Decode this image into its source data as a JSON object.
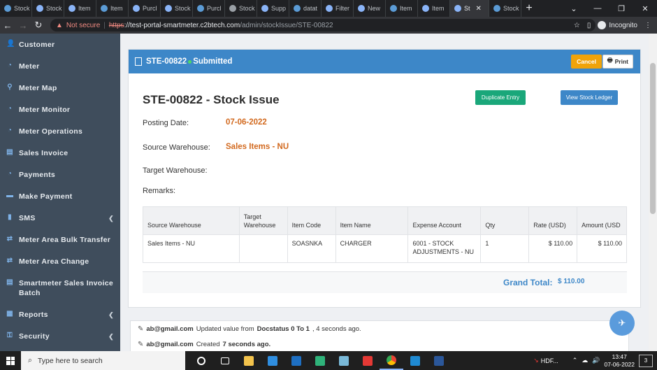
{
  "browser": {
    "tabs": [
      {
        "label": "Stock",
        "active": false
      },
      {
        "label": "Stock",
        "active": false
      },
      {
        "label": "Item",
        "active": false
      },
      {
        "label": "Item",
        "active": false
      },
      {
        "label": "Purcl",
        "active": false
      },
      {
        "label": "Stock",
        "active": false
      },
      {
        "label": "Purcl",
        "active": false
      },
      {
        "label": "Stock",
        "active": false
      },
      {
        "label": "Supp",
        "active": false
      },
      {
        "label": "datat",
        "active": false
      },
      {
        "label": "Filter",
        "active": false
      },
      {
        "label": "New",
        "active": false
      },
      {
        "label": "Item",
        "active": false
      },
      {
        "label": "Item",
        "active": false
      },
      {
        "label": "St",
        "active": true
      },
      {
        "label": "Stock",
        "active": false
      }
    ],
    "new_tab": "+",
    "security_label": "Not secure",
    "url_scheme": "https",
    "url_host": "://test-portal-smartmeter.c2btech.com",
    "url_path": "/admin/stockIssue/STE-00822",
    "profile_label": "Incognito"
  },
  "sidebar": {
    "items": [
      {
        "label": "Customer",
        "icon": "user-icon",
        "submenu": false
      },
      {
        "label": "Meter",
        "icon": "meter-icon",
        "submenu": false
      },
      {
        "label": "Meter Map",
        "icon": "map-pin-icon",
        "submenu": false
      },
      {
        "label": "Meter Monitor",
        "icon": "meter-icon",
        "submenu": false
      },
      {
        "label": "Meter Operations",
        "icon": "meter-icon",
        "submenu": false
      },
      {
        "label": "Sales Invoice",
        "icon": "file-icon",
        "submenu": false
      },
      {
        "label": "Payments",
        "icon": "meter-icon",
        "submenu": false
      },
      {
        "label": "Make Payment",
        "icon": "money-icon",
        "submenu": false
      },
      {
        "label": "SMS",
        "icon": "mobile-icon",
        "submenu": true
      },
      {
        "label": "Meter Area Bulk Transfer",
        "icon": "transfer-icon",
        "submenu": false
      },
      {
        "label": "Meter Area Change",
        "icon": "transfer-icon",
        "submenu": false
      },
      {
        "label": "Smartmeter Sales Invoice Batch",
        "icon": "file-icon",
        "submenu": false
      },
      {
        "label": "Reports",
        "icon": "report-icon",
        "submenu": true
      },
      {
        "label": "Security",
        "icon": "lock-icon",
        "submenu": true
      }
    ]
  },
  "doc": {
    "header_id": "STE-00822",
    "status": "Submitted",
    "cancel_label": "Cancel",
    "print_label": "Print",
    "title": "STE-00822 - Stock Issue",
    "duplicate_label": "Duplicate Entry",
    "ledger_label": "View Stock Ledger",
    "posting_date_label": "Posting Date:",
    "posting_date": "07-06-2022",
    "source_wh_label": "Source Warehouse:",
    "source_wh": "Sales Items - NU",
    "target_wh_label": "Target Warehouse:",
    "remarks_label": "Remarks:",
    "columns": [
      "Source Warehouse",
      "Target Warehouse",
      "Item Code",
      "Item Name",
      "Expense Account",
      "Qty",
      "Rate (USD)",
      "Amount (USD"
    ],
    "rows": [
      {
        "source_wh": "Sales Items - NU",
        "target_wh": "",
        "item_code": "SOASNKA",
        "item_name": "CHARGER",
        "expense_account": "6001 - STOCK ADJUSTMENTS - NU",
        "qty": "1",
        "rate": "$ 110.00",
        "amount": "$ 110.00"
      }
    ],
    "grand_total_label": "Grand Total:",
    "grand_total": "$ 110.00"
  },
  "activity": [
    {
      "user": "ab@gmail.com",
      "text_a": "Updated value from",
      "field": "Docstatus 0 To 1",
      "text_b": ", 4 seconds ago."
    },
    {
      "user": "ab@gmail.com",
      "text_a": "Created",
      "field": "7 seconds ago.",
      "text_b": ""
    }
  ],
  "taskbar": {
    "search_placeholder": "Type here to search",
    "tray_label": "HDF...",
    "time": "13:47",
    "date": "07-06-2022",
    "notifications": "3"
  },
  "colors": {
    "sidebar_bg": "#3f4d5c",
    "header_blue": "#3d87c8",
    "cancel_orange": "#f0a30a",
    "duplicate_green": "#1aa77a",
    "value_orange": "#d2691e"
  }
}
